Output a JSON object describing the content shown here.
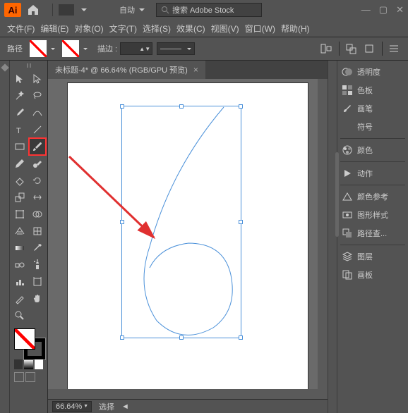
{
  "app": {
    "logo_text": "Ai",
    "auto_label": "自动",
    "search_placeholder": "搜索 Adobe Stock"
  },
  "menu": {
    "file": "文件(F)",
    "edit": "编辑(E)",
    "object": "对象(O)",
    "type": "文字(T)",
    "select": "选择(S)",
    "effect": "效果(C)",
    "view": "视图(V)",
    "window": "窗口(W)",
    "help": "帮助(H)"
  },
  "control": {
    "path_label": "路径",
    "stroke_label": "描边 :"
  },
  "doc": {
    "tab_title": "未标题-4* @ 66.64% (RGB/GPU 预览)"
  },
  "status": {
    "zoom": "66.64%",
    "mode": "选择"
  },
  "panels": {
    "transparency": "透明度",
    "swatches": "色板",
    "brushes": "画笔",
    "symbols": "符号",
    "color": "颜色",
    "actions": "动作",
    "color_guide": "颜色参考",
    "graphic_styles": "图形样式",
    "path_find": "路径查...",
    "layers": "图层",
    "artboards": "画板"
  }
}
